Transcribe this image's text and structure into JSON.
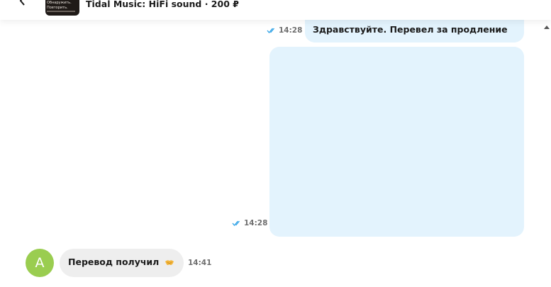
{
  "header": {
    "product_title": "Tidal Music: HiFi sound · 200 ₽",
    "thumb_lines": [
      "Обнаружить.",
      "Повторить."
    ]
  },
  "messages": [
    {
      "direction": "out",
      "text": "Здравствуйте. Перевел за продление",
      "time": "14:28",
      "status": "read"
    },
    {
      "direction": "out",
      "type": "media",
      "time": "14:28",
      "status": "read"
    },
    {
      "direction": "in",
      "avatar_letter": "A",
      "text": "Перевод получил",
      "emoji_icon": "handshake-icon",
      "time": "14:41"
    }
  ],
  "colors": {
    "outgoing_bubble": "#e3f3fd",
    "incoming_bubble": "#eeeeee",
    "avatar": "#9acd50",
    "read_ticks": "#2aa0e6"
  }
}
